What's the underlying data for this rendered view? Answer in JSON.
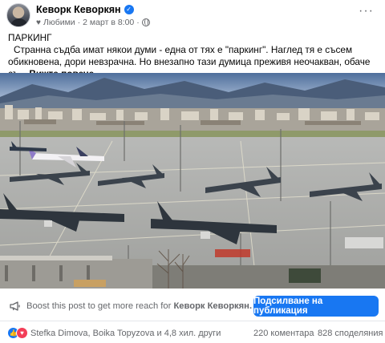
{
  "post": {
    "author": "Кеворк Кеворкян",
    "audience_label": "Любими",
    "timestamp": "2 март в 8:00",
    "separator": "·",
    "title": "ПАРКИНГ",
    "body": "Странна съдба имат някои думи - една от тях е \"паркинг\". Наглед тя е съсем обикновена, дори невзрачна. Но внезапно тази думица преживя неочакван, обаче съ...",
    "see_more": "Вижте повече"
  },
  "boost": {
    "prefix": "Boost this post to get more reach for",
    "name": "Кеворк Кеворкян."
  },
  "cta_label": "Подсилване на публикация",
  "footer": {
    "reacted_by": "Stefka Dimova, Boika Topyzova и 4,8 хил. други",
    "comments": "220 коментара",
    "shares": "828 споделяния"
  },
  "icons": {
    "more": "more-options-icon",
    "verified": "verified-badge-icon",
    "favorites": "heart-icon",
    "privacy": "globe-icon",
    "boost": "megaphone-icon",
    "like": "like-reaction-icon",
    "love": "love-reaction-icon"
  },
  "colors": {
    "accent": "#1877f2",
    "secondary_text": "#65676b",
    "love": "#f33e58"
  }
}
